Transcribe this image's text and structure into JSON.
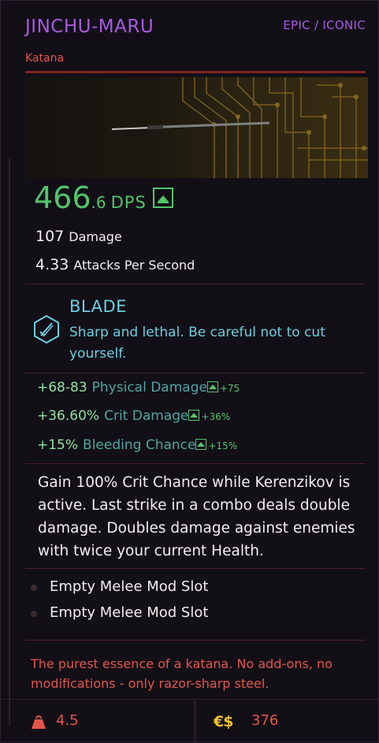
{
  "item": {
    "name": "JINCHU-MARU",
    "rarity": "EPIC / ICONIC",
    "type": "Katana"
  },
  "dps": {
    "integer": "466",
    "decimal": ".6",
    "unit": "DPS",
    "trend_icon": "arrow-up-icon"
  },
  "stats": {
    "damage_value": "107",
    "damage_label": "Damage",
    "aps_value": "4.33",
    "aps_label": "Attacks Per Second"
  },
  "blade": {
    "title": "BLADE",
    "description": "Sharp and lethal. Be careful not to cut yourself.",
    "icon": "blade-icon"
  },
  "mods": [
    {
      "value": "+68-83",
      "name": "Physical Damage",
      "increase": "+75"
    },
    {
      "value": "+36.60%",
      "name": "Crit Damage",
      "increase": "+36%"
    },
    {
      "value": "+15%",
      "name": "Bleeding Chance",
      "increase": "+15%"
    }
  ],
  "effect_text": "Gain 100% Crit Chance while Kerenzikov is active. Last strike in a combo deals double damage. Doubles damage against enemies with twice your current Health.",
  "slots": [
    {
      "label": "Empty Melee Mod Slot"
    },
    {
      "label": "Empty Melee Mod Slot"
    }
  ],
  "flavor_text": "The purest essence of a katana. No add-ons, no modifications - only razor-sharp steel.",
  "footer": {
    "weight": "4.5",
    "weight_icon": "weight-icon",
    "currency_symbol": "€$",
    "price": "376"
  },
  "colors": {
    "rarity": "#a85ae0",
    "positive": "#54c46a",
    "accent_red": "#e4564b",
    "blade": "#6ad0e0",
    "mod_name": "#4fa7a2",
    "eddies": "#f2c230"
  }
}
